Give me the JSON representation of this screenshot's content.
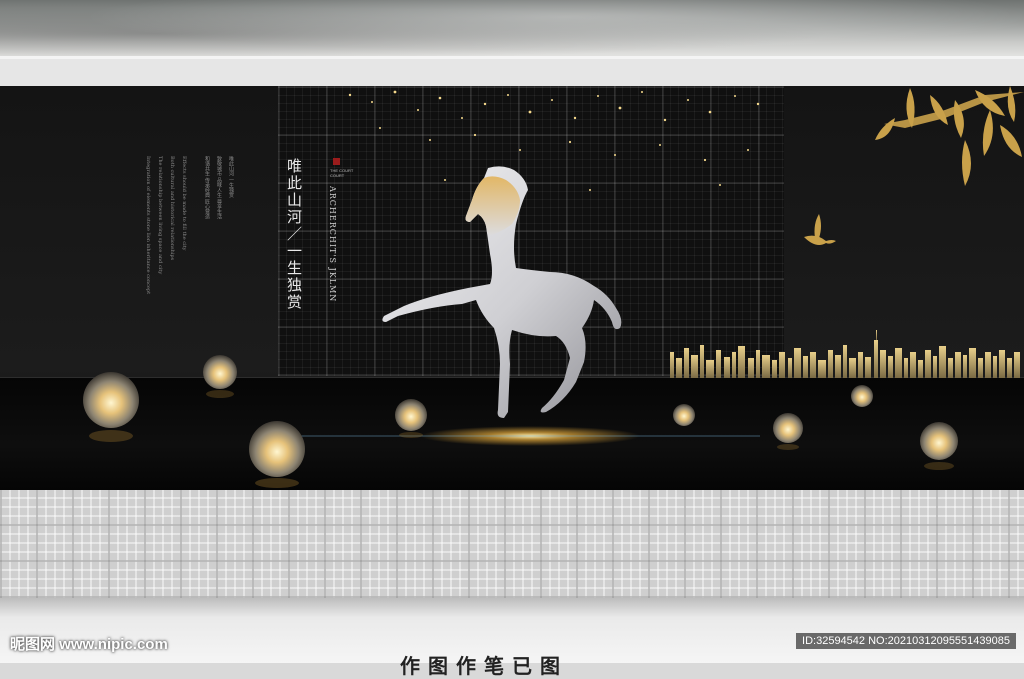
{
  "headline": "唯此山河／一生独赏",
  "english_title": "ARCHERCHIT'S JKLMN",
  "seal_text": [
    "THE COURT",
    "COURT"
  ],
  "body_text_columns": [
    "Integration of elements stone lion inheritance concept",
    "The relationship between living space and city",
    "Both cultural and historical relationships",
    "Effects should be made to fill the city",
    "和谐共生 传承经典 匠心营造",
    "致敬城市 品味人生 尊享生活",
    "唯此山河 一生独赏"
  ],
  "watermark_left": "昵图网 www.nipic.com",
  "watermark_right": "ID:32594542 NO:20210312095551439085",
  "caption": "作图作笔已图",
  "colors": {
    "board": "#161616",
    "gold": "#c9a14a",
    "silver": "#d8d8dc",
    "wall": "#cfcfcf"
  },
  "icons": [
    "horse-sculpture",
    "bird-icon",
    "bamboo-leaves",
    "lantern-ball",
    "city-skyline"
  ]
}
